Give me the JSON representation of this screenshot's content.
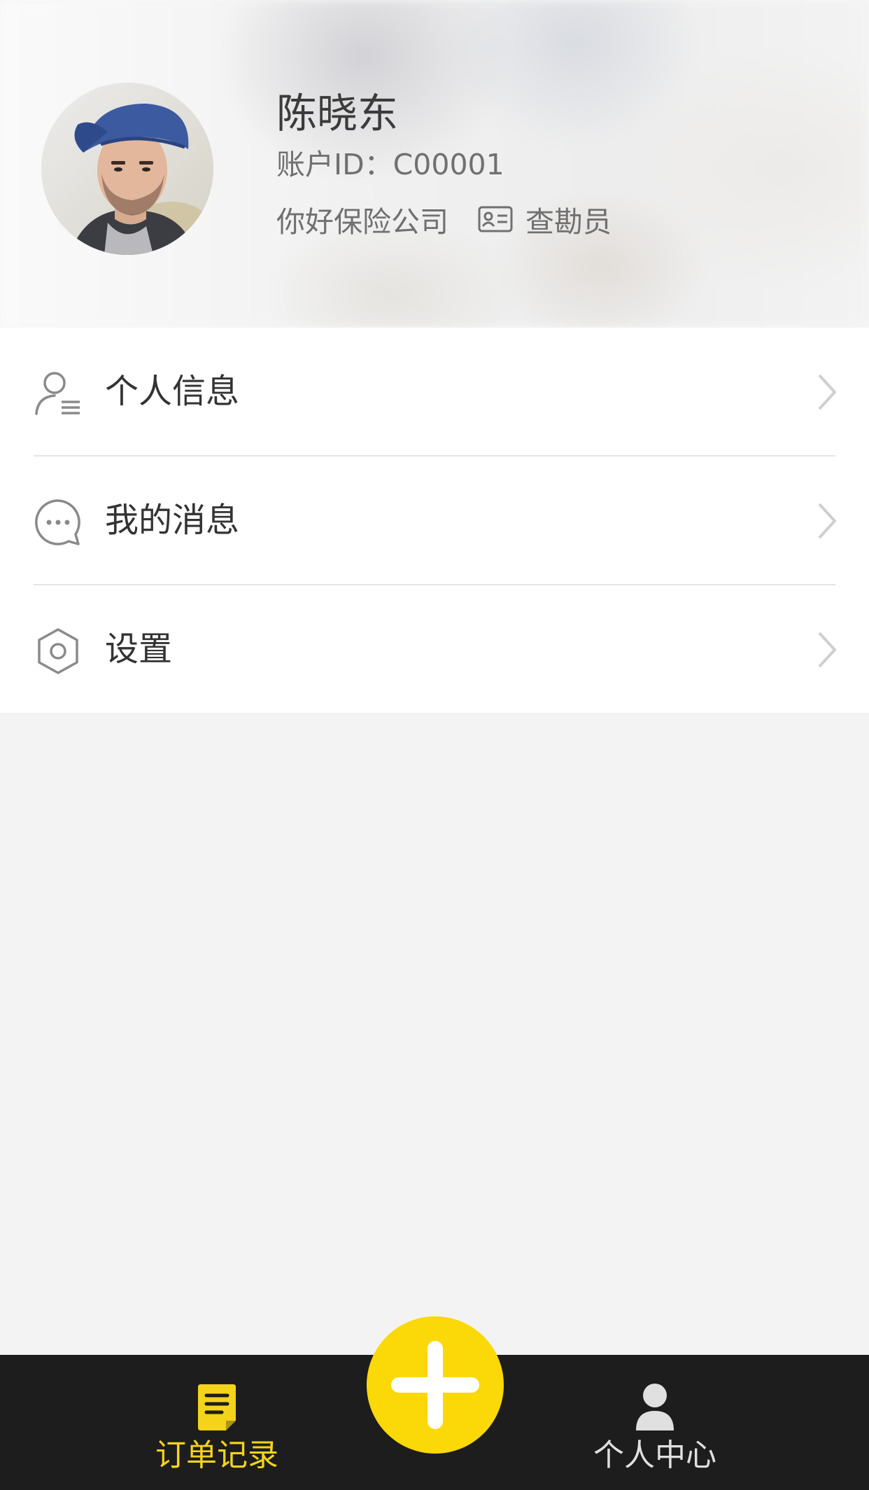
{
  "header": {
    "user_name": "陈晓东",
    "account_id": "账户ID：C00001",
    "company": "你好保险公司",
    "role": "查勘员"
  },
  "menu": {
    "items": [
      {
        "label": "个人信息",
        "icon": "person-list-icon"
      },
      {
        "label": "我的消息",
        "icon": "chat-bubble-icon"
      },
      {
        "label": "设置",
        "icon": "gear-icon"
      }
    ]
  },
  "bottom_nav": {
    "orders_label": "订单记录",
    "profile_label": "个人中心",
    "add_button": "plus-icon",
    "active_tab": "订单记录"
  },
  "colors": {
    "accent": "#fbd807",
    "active_tab_text": "#f4d31b",
    "nav_background": "#1d1d1d",
    "page_background": "#f3f3f3"
  }
}
